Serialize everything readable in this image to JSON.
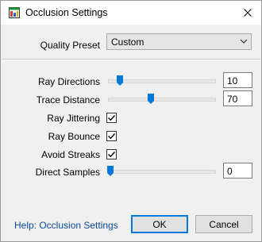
{
  "window": {
    "title": "Occlusion Settings",
    "icon": "app-icon",
    "close_icon": "close-icon"
  },
  "quality_preset": {
    "label": "Quality Preset",
    "value": "Custom"
  },
  "ray_directions": {
    "label": "Ray Directions",
    "value": "10",
    "slider_fraction": 0.09
  },
  "trace_distance": {
    "label": "Trace Distance",
    "value": "70",
    "slider_fraction": 0.39
  },
  "ray_jittering": {
    "label": "Ray Jittering",
    "checked": true
  },
  "ray_bounce": {
    "label": "Ray Bounce",
    "checked": true
  },
  "avoid_streaks": {
    "label": "Avoid Streaks",
    "checked": true
  },
  "direct_samples": {
    "label": "Direct Samples",
    "value": "0",
    "slider_fraction": 0.0
  },
  "footer": {
    "help_link": "Help: Occlusion Settings",
    "ok_label": "OK",
    "cancel_label": "Cancel"
  },
  "colors": {
    "accent": "#0078d7",
    "link": "#0a4a9c"
  }
}
